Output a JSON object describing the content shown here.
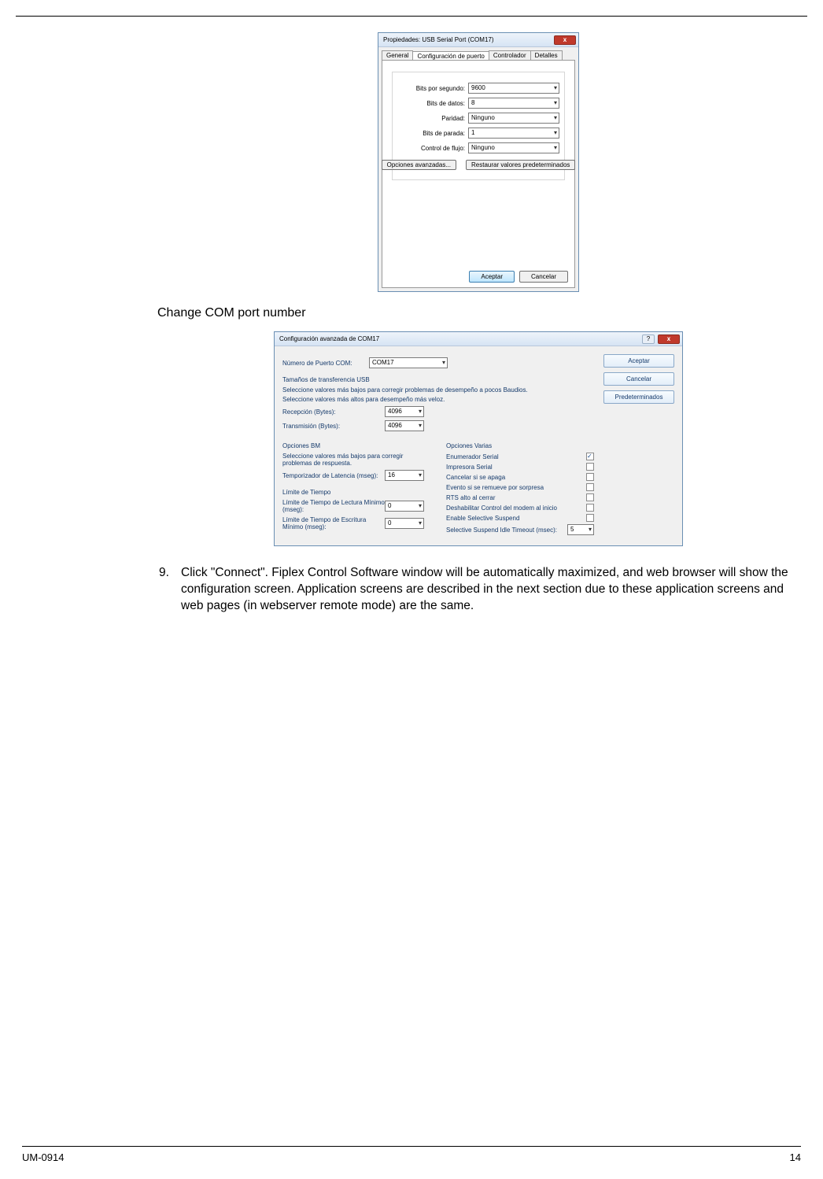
{
  "dialog1": {
    "title": "Propiedades: USB Serial Port (COM17)",
    "tabs": [
      "General",
      "Configuración de puerto",
      "Controlador",
      "Detalles"
    ],
    "active_tab": 1,
    "fields": {
      "bps": {
        "label": "Bits por segundo:",
        "value": "9600"
      },
      "databits": {
        "label": "Bits de datos:",
        "value": "8"
      },
      "parity": {
        "label": "Paridad:",
        "value": "Ninguno"
      },
      "stopbits": {
        "label": "Bits de parada:",
        "value": "1"
      },
      "flow": {
        "label": "Control de flujo:",
        "value": "Ninguno"
      }
    },
    "buttons": {
      "advanced": "Opciones avanzadas...",
      "restore": "Restaurar valores predeterminados",
      "accept": "Aceptar",
      "cancel": "Cancelar"
    }
  },
  "caption": "Change COM port number",
  "dialog2": {
    "title": "Configuración avanzada de COM17",
    "port_label": "Número de Puerto COM:",
    "port_value": "COM17",
    "right_buttons": {
      "accept": "Aceptar",
      "cancel": "Cancelar",
      "defaults": "Predeterminados"
    },
    "usb_header": "Tamaños de transferencia USB",
    "usb_line1": "Seleccione valores más bajos para corregir problemas de desempeño a pocos Baudios.",
    "usb_line2": "Seleccione valores más altos para desempeño más veloz.",
    "rx": {
      "label": "Recepción (Bytes):",
      "value": "4096"
    },
    "tx": {
      "label": "Transmisión (Bytes):",
      "value": "4096"
    },
    "bm_header": "Opciones BM",
    "bm_line": "Seleccione valores más bajos para corregir problemas de respuesta.",
    "latency": {
      "label": "Temporizador de Latencia (mseg):",
      "value": "16"
    },
    "time_header": "Límite de Tiempo",
    "read_to": {
      "label": "Límite de Tiempo de Lectura Mínimo (mseg):",
      "value": "0"
    },
    "write_to": {
      "label": "Límite de Tiempo de Escritura Mínimo (mseg):",
      "value": "0"
    },
    "misc_header": "Opciones Varias",
    "misc": [
      {
        "label": "Enumerador Serial",
        "checked": true
      },
      {
        "label": "Impresora Serial",
        "checked": false
      },
      {
        "label": "Cancelar si se apaga",
        "checked": false
      },
      {
        "label": "Evento si se remueve por sorpresa",
        "checked": false
      },
      {
        "label": "RTS alto al cerrar",
        "checked": false
      },
      {
        "label": "Deshabilitar Control del modem al inicio",
        "checked": false
      },
      {
        "label": "Enable Selective Suspend",
        "checked": false
      }
    ],
    "ss_idle": {
      "label": "Selective Suspend Idle Timeout (msec):",
      "value": "5"
    }
  },
  "step": {
    "num": "9.",
    "text": "Click \"Connect\".  Fiplex Control Software window will be automatically maximized, and web browser will show the configuration screen. Application screens are described in the next section due to these application screens and web pages (in webserver remote mode) are the same."
  },
  "footer": {
    "left": "UM-0914",
    "right": "14"
  }
}
